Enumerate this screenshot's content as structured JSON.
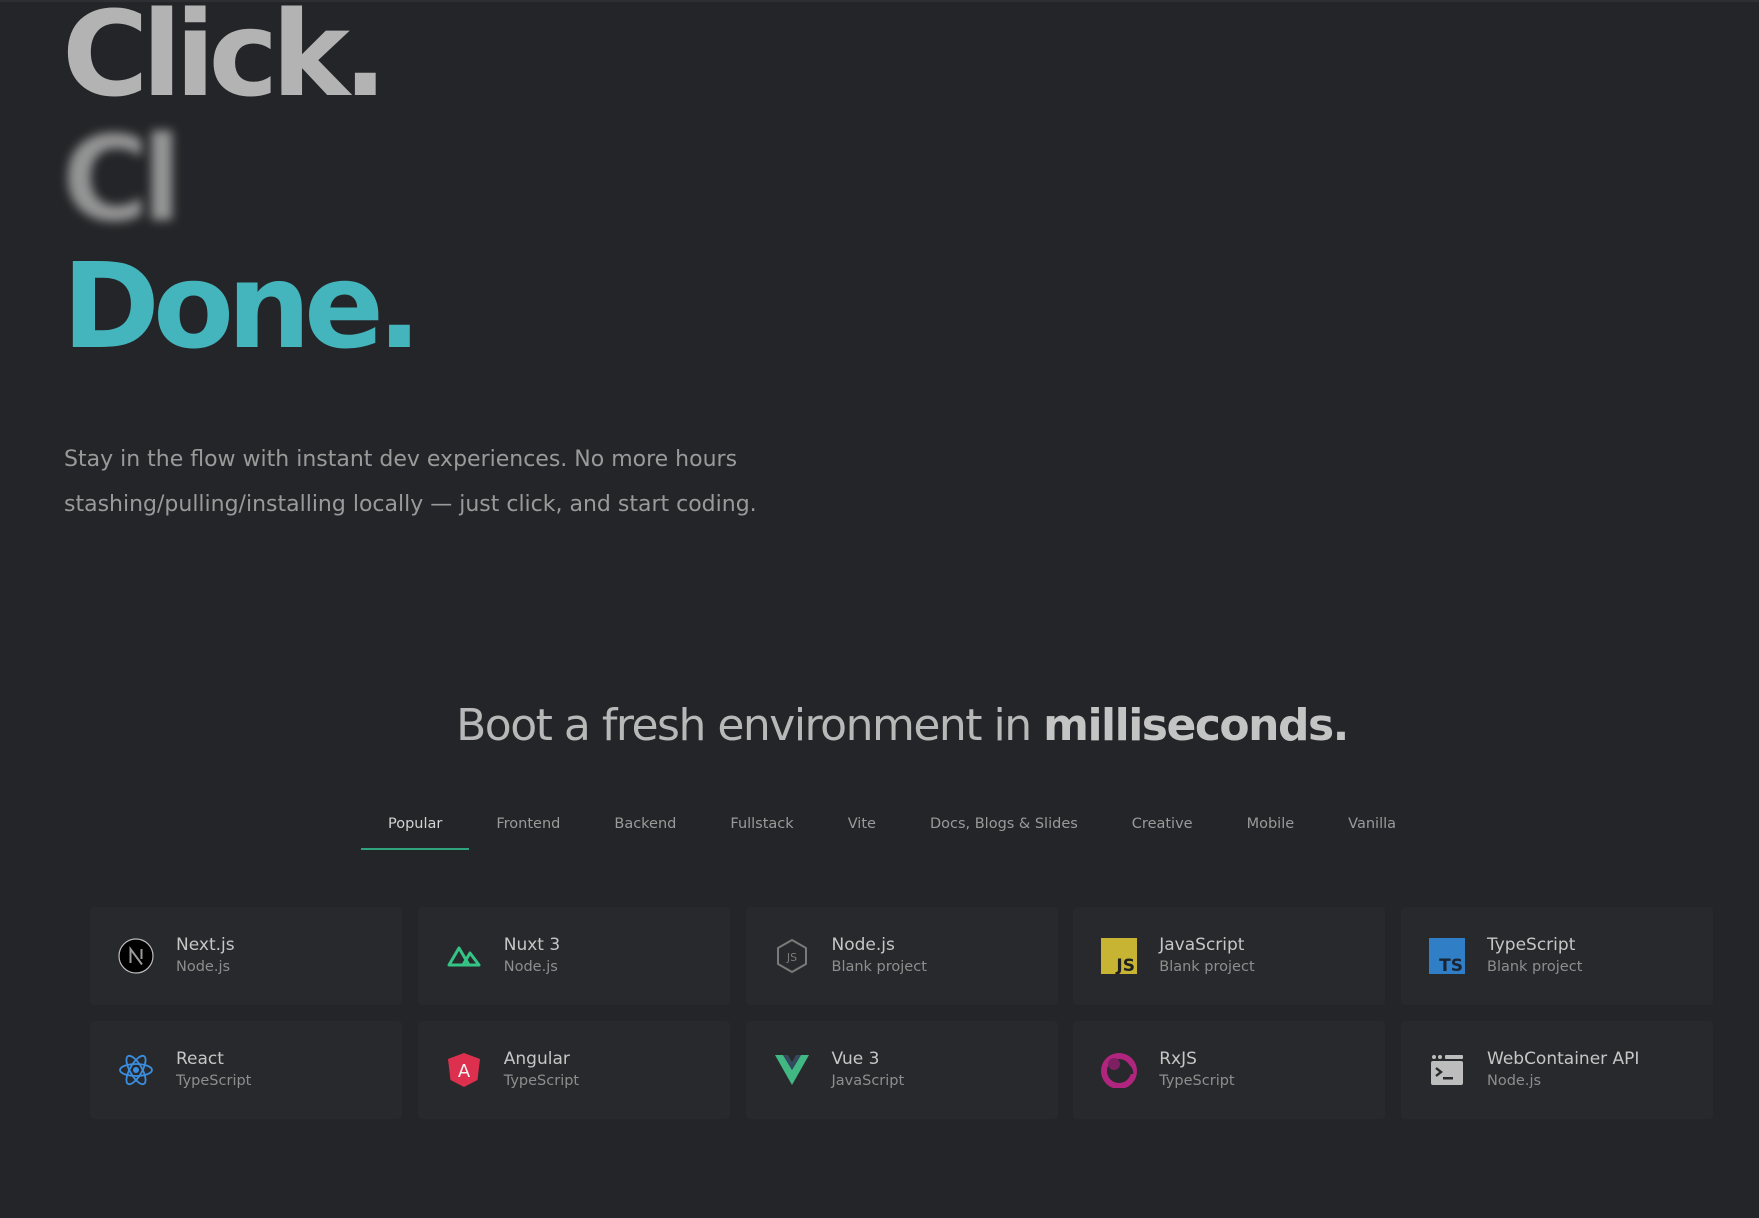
{
  "hero": {
    "line1": "Click.",
    "line2": "Cl",
    "line3": "Done.",
    "subtitle": "Stay in the flow with instant dev experiences. No more hours stashing/pulling/installing locally — just click, and start coding.",
    "accent_color": "#44b5bd"
  },
  "boot": {
    "title_regular": "Boot a fresh environment in ",
    "title_bold": "milliseconds."
  },
  "tabs": [
    {
      "label": "Popular",
      "active": true
    },
    {
      "label": "Frontend"
    },
    {
      "label": "Backend"
    },
    {
      "label": "Fullstack"
    },
    {
      "label": "Vite"
    },
    {
      "label": "Docs, Blogs & Slides"
    },
    {
      "label": "Creative"
    },
    {
      "label": "Mobile"
    },
    {
      "label": "Vanilla"
    }
  ],
  "templates": [
    {
      "name": "Next.js",
      "sub": "Node.js",
      "icon": "nextjs-icon"
    },
    {
      "name": "Nuxt 3",
      "sub": "Node.js",
      "icon": "nuxt-icon"
    },
    {
      "name": "Node.js",
      "sub": "Blank project",
      "icon": "nodejs-icon"
    },
    {
      "name": "JavaScript",
      "sub": "Blank project",
      "icon": "javascript-icon",
      "icon_text": "JS"
    },
    {
      "name": "TypeScript",
      "sub": "Blank project",
      "icon": "typescript-icon",
      "icon_text": "TS"
    },
    {
      "name": "React",
      "sub": "TypeScript",
      "icon": "react-icon"
    },
    {
      "name": "Angular",
      "sub": "TypeScript",
      "icon": "angular-icon",
      "icon_text": "A"
    },
    {
      "name": "Vue 3",
      "sub": "JavaScript",
      "icon": "vue-icon"
    },
    {
      "name": "RxJS",
      "sub": "TypeScript",
      "icon": "rxjs-icon"
    },
    {
      "name": "WebContainer API",
      "sub": "Node.js",
      "icon": "terminal-icon"
    }
  ]
}
